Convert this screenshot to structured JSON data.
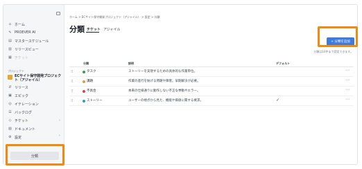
{
  "sidebar": {
    "items": [
      {
        "icon": "home-icon",
        "glyph": "⌂",
        "label": "ホーム"
      },
      {
        "icon": "ai-icon",
        "glyph": "✎",
        "label": "PROEVER AI"
      },
      {
        "icon": "schedule-icon",
        "glyph": "▤",
        "label": "マスタースケジュール"
      },
      {
        "icon": "review-icon",
        "glyph": "▥",
        "label": "リリースビュー"
      },
      {
        "icon": "ticket-icon",
        "glyph": "▦",
        "label": "チケット"
      }
    ],
    "section_label": "プロジェクト",
    "project_name": "ECサイト保守開発プロジェクト（アジャイル）",
    "project_items": [
      {
        "icon": "release-icon",
        "glyph": "⇵",
        "label": "リリース"
      },
      {
        "icon": "epic-icon",
        "glyph": "▣",
        "label": "エピック"
      },
      {
        "icon": "iteration-icon",
        "glyph": "◎",
        "label": "イテレーション"
      },
      {
        "icon": "backlog-icon",
        "glyph": "☰",
        "label": "バックログ"
      },
      {
        "icon": "ticket-icon",
        "glyph": "◇",
        "label": "チケット"
      },
      {
        "icon": "document-icon",
        "glyph": "▧",
        "label": "ドキュメント"
      },
      {
        "icon": "settings-icon",
        "glyph": "⚙",
        "label": "設定"
      }
    ],
    "bottom_item": "分類"
  },
  "breadcrumb": "ホーム > ECサイト保守開発プロジェクト（アジャイル） > 設定 > 分類",
  "page_title": "分類",
  "tabs": [
    {
      "label": "チケット",
      "active": true
    },
    {
      "label": "アジャイル",
      "active": false
    }
  ],
  "add_button": "+ 分類を追加",
  "hint": "分類は10件まで設定できます。",
  "table": {
    "headers": [
      "分類",
      "説明",
      "デフォルト"
    ],
    "rows": [
      {
        "name": "タスク",
        "color": "#3e9b4f",
        "description": "ストーリーを実現するための具体的な作業単位。",
        "default": false
      },
      {
        "name": "課題",
        "color": "#e89a2c",
        "description": "作業の進行を妨げる問題や障害。早期解決が必要。",
        "default": false
      },
      {
        "name": "不具合",
        "color": "#d9453d",
        "description": "本来の仕様通りに動作しない不正な挙動やエラー。",
        "default": false
      },
      {
        "name": "ストーリー",
        "color": "#2f9fb5",
        "description": "ユーザーの視点から見た、機能や価値に関する要求。",
        "default": true
      }
    ]
  }
}
